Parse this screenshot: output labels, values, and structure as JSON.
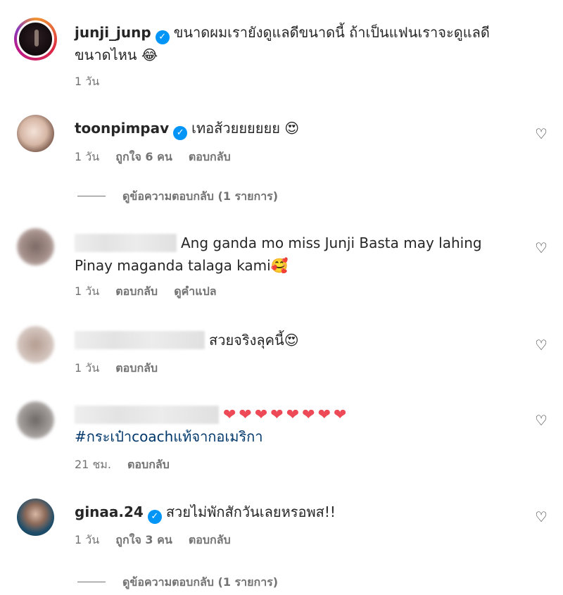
{
  "comments": [
    {
      "username": "junji_junp",
      "verified": true,
      "text_line1": "ขนาดผมเรายังดูแลดีขนาดนี้ ถ้าเป็นแฟนเราจะดูแลดี",
      "text_line2": "ขนาดไหน 😂",
      "time": "1 วัน"
    },
    {
      "username": "toonpimpav",
      "verified": true,
      "text": "เทอส้วยยยยยย 😍",
      "time": "1 วัน",
      "likes": "ถูกใจ 6 คน",
      "reply_label": "ตอบกลับ",
      "view_replies": "ดูข้อความตอบกลับ (1 รายการ)"
    },
    {
      "username_hidden": true,
      "text_line1": "Ang ganda mo miss Junji Basta may lahing",
      "text_line2": "Pinay maganda talaga kami🥰",
      "time": "1 วัน",
      "reply_label": "ตอบกลับ",
      "translate_label": "ดูคำแปล"
    },
    {
      "username_hidden": true,
      "text": "สวยจริงลุคนี้😍",
      "time": "1 วัน",
      "reply_label": "ตอบกลับ"
    },
    {
      "username_hidden": true,
      "text": "❤❤❤❤❤❤❤❤",
      "hashtag": "#กระเป๋าcoachแท้จากอเมริกา",
      "time": "21 ชม.",
      "reply_label": "ตอบกลับ"
    },
    {
      "username": "ginaa.24",
      "verified": true,
      "text": "สวยไม่พักสักวันเลยหรอพส!!",
      "time": "1 วัน",
      "likes": "ถูกใจ 3 คน",
      "reply_label": "ตอบกลับ",
      "view_replies": "ดูข้อความตอบกลับ (1 รายการ)"
    }
  ],
  "icons": {
    "verified": "verified-badge-icon",
    "like": "heart-outline-icon"
  },
  "colors": {
    "verified": "#0095f6",
    "heart_red": "#ed4956",
    "hashtag": "#00376b",
    "meta": "#737373"
  }
}
